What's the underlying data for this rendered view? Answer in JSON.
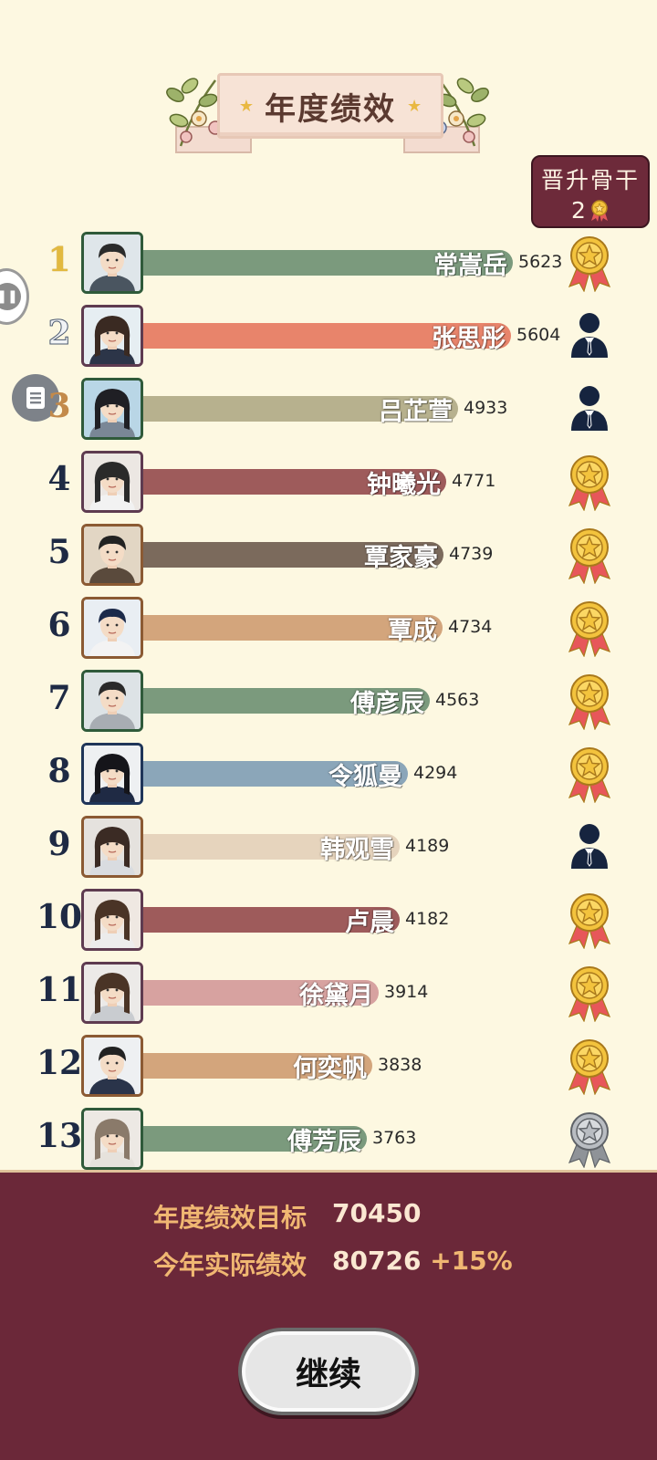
{
  "title": "年度绩效",
  "promote": {
    "title": "晋升骨干",
    "count": "2"
  },
  "rows": [
    {
      "rank": "1",
      "name": "常嵩岳",
      "score": "5623",
      "status": "medal-icon",
      "color": "#7b9a7d",
      "frame": "#2f5a3a",
      "shirt": "#4a5560",
      "hair": "#2b2b2b",
      "bg": "#dfe6ea",
      "gender": "m"
    },
    {
      "rank": "2",
      "name": "张思彤",
      "score": "5604",
      "status": "businessman-icon",
      "color": "#e8846b",
      "frame": "#5e3b50",
      "shirt": "#2c3548",
      "hair": "#3a2a22",
      "bg": "#e6eef2",
      "gender": "f"
    },
    {
      "rank": "3",
      "name": "吕芷萱",
      "score": "4933",
      "status": "businessman-icon",
      "color": "#b7b18e",
      "frame": "#2f5a3a",
      "shirt": "#7a8796",
      "hair": "#1f1f24",
      "bg": "#b9d6e6",
      "gender": "f"
    },
    {
      "rank": "4",
      "name": "钟曦光",
      "score": "4771",
      "status": "medal-icon",
      "color": "#9e5b5b",
      "frame": "#5e3b50",
      "shirt": "#f2f2f2",
      "hair": "#2a2a2a",
      "bg": "#ece7e3",
      "gender": "f"
    },
    {
      "rank": "5",
      "name": "覃家豪",
      "score": "4739",
      "status": "medal-icon",
      "color": "#7b6a5c",
      "frame": "#8b5a33",
      "shirt": "#5a4a3c",
      "hair": "#222",
      "bg": "#e2d6c4",
      "gender": "m"
    },
    {
      "rank": "6",
      "name": "覃成",
      "score": "4734",
      "status": "medal-icon",
      "color": "#d3a57c",
      "frame": "#8b5a33",
      "shirt": "#f3f3f3",
      "hair": "#1c2a4a",
      "bg": "#e9eef3",
      "gender": "m"
    },
    {
      "rank": "7",
      "name": "傅彦辰",
      "score": "4563",
      "status": "medal-icon",
      "color": "#7b9a7d",
      "frame": "#2f5a3a",
      "shirt": "#a8adb3",
      "hair": "#2a2a2a",
      "bg": "#dde3e6",
      "gender": "m"
    },
    {
      "rank": "8",
      "name": "令狐曼",
      "score": "4294",
      "status": "medal-icon",
      "color": "#8ba6b9",
      "frame": "#1f3559",
      "shirt": "#1f2a44",
      "hair": "#15151a",
      "bg": "#eef0f2",
      "gender": "f"
    },
    {
      "rank": "9",
      "name": "韩观雪",
      "score": "4189",
      "status": "businessman-icon",
      "color": "#e6d4bd",
      "frame": "#8b5a33",
      "shirt": "#d9dce0",
      "hair": "#3b2b24",
      "bg": "#e5e2de",
      "gender": "f"
    },
    {
      "rank": "10",
      "name": "卢晨",
      "score": "4182",
      "status": "medal-icon",
      "color": "#9e5b5b",
      "frame": "#5e3b50",
      "shirt": "#ececec",
      "hair": "#4a3426",
      "bg": "#efe8e2",
      "gender": "f"
    },
    {
      "rank": "11",
      "name": "徐黛月",
      "score": "3914",
      "status": "medal-icon",
      "color": "#d7a2a0",
      "frame": "#5e3b50",
      "shirt": "#c9ccd0",
      "hair": "#4a3426",
      "bg": "#eceae8",
      "gender": "f"
    },
    {
      "rank": "12",
      "name": "何奕帆",
      "score": "3838",
      "status": "medal-icon",
      "color": "#d3a57c",
      "frame": "#8b5a33",
      "shirt": "#2a344a",
      "hair": "#222",
      "bg": "#eef0f2",
      "gender": "m"
    },
    {
      "rank": "13",
      "name": "傅芳辰",
      "score": "3763",
      "status": "silver-medal-icon",
      "color": "#7b9a7d",
      "frame": "#2f5a3a",
      "shirt": "#e6e2dc",
      "hair": "#8a7a6a",
      "bg": "#ede9e4",
      "gender": "f"
    }
  ],
  "stats": {
    "target_label": "年度绩效目标",
    "target_value": "70450",
    "actual_label": "今年实际绩效",
    "actual_value": "80726",
    "actual_delta": "+15%"
  },
  "continue_label": "继续"
}
